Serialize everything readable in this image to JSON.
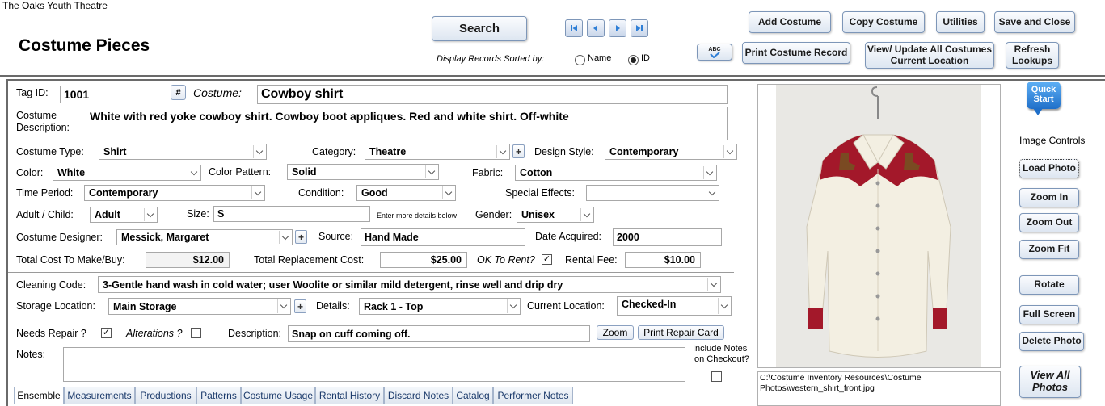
{
  "app_title": "The Oaks Youth Theatre",
  "form_title": "Costume Pieces",
  "header": {
    "search_label": "Search",
    "sort_label": "Display Records Sorted by:",
    "sort_name": "Name",
    "sort_id": "ID",
    "sort_selected": "ID",
    "add_costume": "Add Costume",
    "copy_costume": "Copy Costume",
    "utilities": "Utilities",
    "save_close": "Save and Close",
    "print_record": "Print Costume Record",
    "view_update_line1": "View/ Update All Costumes",
    "view_update_line2": "Current Location",
    "refresh_line1": "Refresh",
    "refresh_line2": "Lookups",
    "spellcheck_glyph": "ABC"
  },
  "record": {
    "tag_id_label": "Tag ID:",
    "tag_id": "1001",
    "hash_btn": "#",
    "costume_label": "Costume:",
    "costume": "Cowboy shirt",
    "desc_label_1": "Costume",
    "desc_label_2": "Description:",
    "description": "White with red yoke cowboy shirt.  Cowboy boot appliques.  Red and white shirt. Off-white",
    "costume_type_label": "Costume Type:",
    "costume_type": "Shirt",
    "category_label": "Category:",
    "category": "Theatre",
    "design_style_label": "Design Style:",
    "design_style": "Contemporary",
    "color_label": "Color:",
    "color": "White",
    "color_pattern_label": "Color Pattern:",
    "color_pattern": "Solid",
    "fabric_label": "Fabric:",
    "fabric": "Cotton",
    "time_period_label": "Time Period:",
    "time_period": "Contemporary",
    "condition_label": "Condition:",
    "condition": "Good",
    "special_effects_label": "Special Effects:",
    "special_effects": "",
    "adult_child_label": "Adult / Child:",
    "adult_child": "Adult",
    "size_label": "Size:",
    "size": "S",
    "size_hint": "Enter more details below",
    "gender_label": "Gender:",
    "gender": "Unisex",
    "designer_label": "Costume Designer:",
    "designer": "Messick, Margaret",
    "source_label": "Source:",
    "source": "Hand Made",
    "date_acquired_label": "Date Acquired:",
    "date_acquired": "2000",
    "total_cost_label": "Total Cost To Make/Buy:",
    "total_cost": "$12.00",
    "replacement_label": "Total Replacement Cost:",
    "replacement": "$25.00",
    "ok_rent_label": "OK To Rent?",
    "ok_rent_checked": true,
    "rental_fee_label": "Rental Fee:",
    "rental_fee": "$10.00",
    "cleaning_label": "Cleaning Code:",
    "cleaning": "3-Gentle hand wash in cold water; user Woolite or similar mild detergent, rinse well and drip dry",
    "storage_label": "Storage Location:",
    "storage": "Main Storage",
    "details_label": "Details:",
    "details": "Rack 1 - Top",
    "current_loc_label": "Current Location:",
    "current_loc": "Checked-In",
    "needs_repair_label": "Needs Repair ?",
    "alterations_label": "Alterations ?",
    "repair_desc_label": "Description:",
    "repair_desc": "Snap on cuff coming off.",
    "zoom_btn": "Zoom",
    "print_repair_btn": "Print Repair Card",
    "notes_label": "Notes:",
    "notes": "",
    "include_notes_1": "Include Notes",
    "include_notes_2": "on Checkout?"
  },
  "image_panel": {
    "path": "C:\\Costume Inventory Resources\\Costume Photos\\western_shirt_front.jpg",
    "quick_start_1": "Quick",
    "quick_start_2": "Start",
    "image_controls_label": "Image Controls",
    "load_photo": "Load Photo",
    "zoom_in": "Zoom In",
    "zoom_out": "Zoom Out",
    "zoom_fit": "Zoom Fit",
    "rotate": "Rotate",
    "full_screen": "Full Screen",
    "delete_photo": "Delete Photo",
    "view_all_1": "View All",
    "view_all_2": "Photos"
  },
  "tabs": [
    "Ensemble",
    "Measurements",
    "Productions",
    "Patterns",
    "Costume Usage",
    "Rental History",
    "Discard Notes",
    "Catalog",
    "Performer Notes"
  ],
  "colors": {
    "accent_blue": "#2f7fd6",
    "shirt_red": "#a3182a",
    "button_border": "#7d96b8"
  }
}
